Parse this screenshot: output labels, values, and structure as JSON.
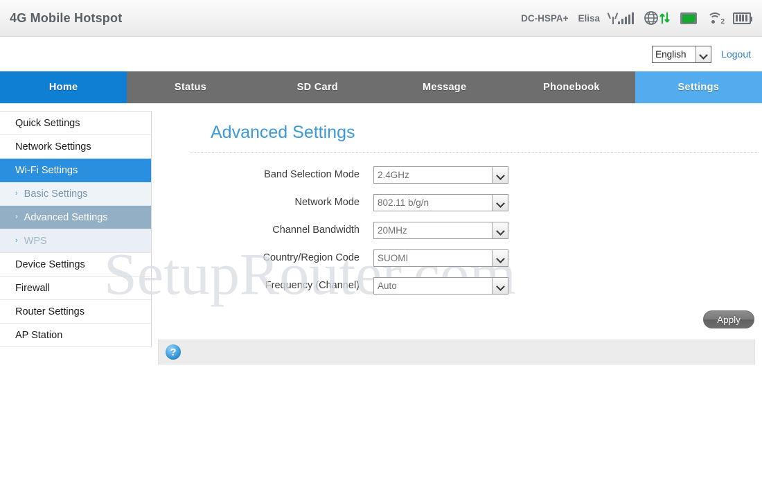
{
  "header": {
    "app_title": "4G Mobile Hotspot",
    "network_type": "DC-HSPA+",
    "carrier": "Elisa",
    "icons": {
      "signal": "signal-bars-icon",
      "globe": "globe-data-transfer-icon",
      "sim": "sim-card-icon",
      "wifi": "wifi-icon",
      "wifi_clients": "2",
      "battery": "battery-icon"
    }
  },
  "toolbar": {
    "language_value": "English",
    "logout_label": "Logout"
  },
  "nav": {
    "tabs": [
      {
        "label": "Home",
        "state": "home-active"
      },
      {
        "label": "Status",
        "state": ""
      },
      {
        "label": "SD Card",
        "state": ""
      },
      {
        "label": "Message",
        "state": ""
      },
      {
        "label": "Phonebook",
        "state": ""
      },
      {
        "label": "Settings",
        "state": "settings-active"
      }
    ]
  },
  "sidebar": {
    "items": [
      {
        "label": "Quick Settings"
      },
      {
        "label": "Network Settings"
      },
      {
        "label": "Wi-Fi Settings"
      },
      {
        "label": "Basic Settings",
        "arrow": "›"
      },
      {
        "label": "Advanced Settings",
        "arrow": "›"
      },
      {
        "label": "WPS",
        "arrow": "›"
      },
      {
        "label": "Device Settings"
      },
      {
        "label": "Firewall"
      },
      {
        "label": "Router Settings"
      },
      {
        "label": "AP Station"
      }
    ]
  },
  "main": {
    "page_title": "Advanced Settings",
    "fields": [
      {
        "label": "Band Selection Mode",
        "value": "2.4GHz"
      },
      {
        "label": "Network Mode",
        "value": "802.11 b/g/n"
      },
      {
        "label": "Channel Bandwidth",
        "value": "20MHz"
      },
      {
        "label": "Country/Region Code",
        "value": "SUOMI"
      },
      {
        "label": "Frequency (Channel)",
        "value": "Auto"
      }
    ],
    "apply_label": "Apply",
    "help_icon_label": "?"
  },
  "watermark": {
    "text": "SetupRouter.com"
  },
  "colors": {
    "accent_blue": "#2b8fe0",
    "tab_active_blue": "#0f7fd4",
    "tab_settings_blue": "#53aced",
    "nav_gray": "#6e6e6e",
    "title_blue": "#3c9ad6",
    "green": "#17a82e"
  }
}
